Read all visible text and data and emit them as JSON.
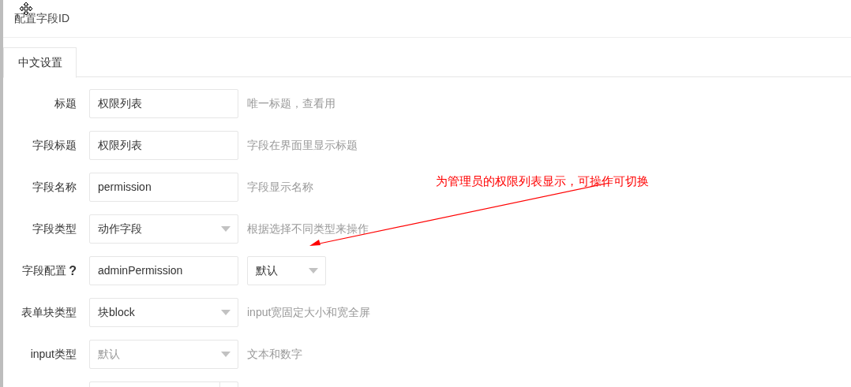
{
  "window": {
    "title": "配置字段ID"
  },
  "tabs": [
    {
      "label": "中文设置",
      "selected": true
    }
  ],
  "form": {
    "rows": [
      {
        "kind": "text",
        "label": "标题",
        "value": "权限列表",
        "help": "唯一标题，查看用"
      },
      {
        "kind": "text",
        "label": "字段标题",
        "value": "权限列表",
        "help": "字段在界面里显示标题"
      },
      {
        "kind": "text",
        "label": "字段名称",
        "value": "permission",
        "help": "字段显示名称"
      },
      {
        "kind": "select",
        "label": "字段类型",
        "value": "动作字段",
        "help": "根据选择不同类型来操作"
      },
      {
        "kind": "text_select",
        "label": "字段配置",
        "hint_mark": "?",
        "value": "adminPermission",
        "option": "默认"
      },
      {
        "kind": "select",
        "label": "表单块类型",
        "value": "块block",
        "help": "input宽固定大小和宽全屏"
      },
      {
        "kind": "select",
        "label": "input类型",
        "placeholder": "默认",
        "help": "文本和数字"
      },
      {
        "kind": "addon"
      }
    ]
  },
  "annotation": {
    "text": "为管理员的权限列表显示，可操作可切换"
  }
}
